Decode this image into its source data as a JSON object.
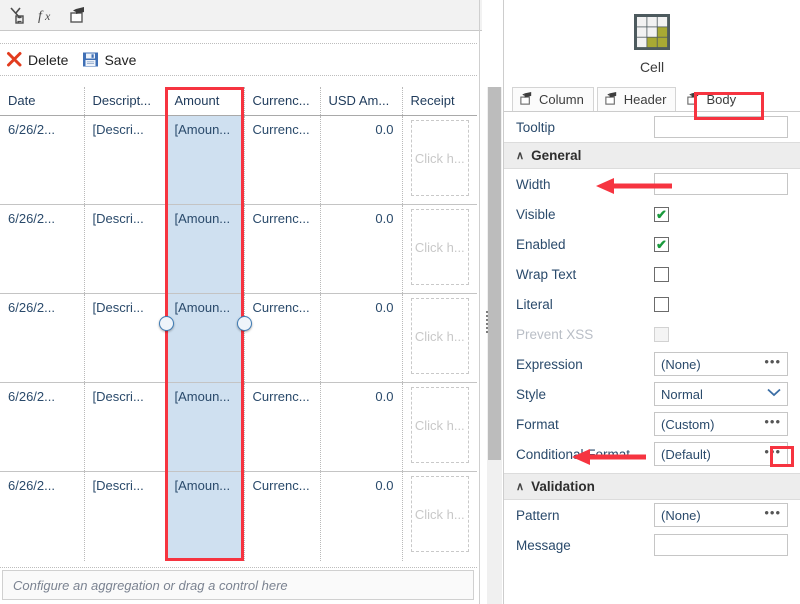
{
  "toolbar": {
    "icons": [
      {
        "name": "transform-icon",
        "label": "Transform"
      },
      {
        "name": "function-fx-icon",
        "label": "fx"
      },
      {
        "name": "control-insert-icon",
        "label": "Insert control"
      }
    ]
  },
  "command_bar": {
    "delete_label": "Delete",
    "save_label": "Save"
  },
  "grid": {
    "columns": [
      {
        "key": "date",
        "label": "Date",
        "align": "left"
      },
      {
        "key": "description",
        "label": "Descript...",
        "align": "left"
      },
      {
        "key": "amount",
        "label": "Amount",
        "align": "left",
        "selected": true
      },
      {
        "key": "currency",
        "label": "Currenc...",
        "align": "left"
      },
      {
        "key": "usd_amount",
        "label": "USD Am...",
        "align": "right"
      },
      {
        "key": "receipt",
        "label": "Receipt",
        "align": "left"
      }
    ],
    "rows": [
      {
        "date": "6/26/2...",
        "description": "[Descri...",
        "amount": "[Amoun...",
        "currency": "Currenc...",
        "usd_amount": "0.0",
        "receipt": "Click h..."
      },
      {
        "date": "6/26/2...",
        "description": "[Descri...",
        "amount": "[Amoun...",
        "currency": "Currenc...",
        "usd_amount": "0.0",
        "receipt": "Click h..."
      },
      {
        "date": "6/26/2...",
        "description": "[Descri...",
        "amount": "[Amoun...",
        "currency": "Currenc...",
        "usd_amount": "0.0",
        "receipt": "Click h..."
      },
      {
        "date": "6/26/2...",
        "description": "[Descri...",
        "amount": "[Amoun...",
        "currency": "Currenc...",
        "usd_amount": "0.0",
        "receipt": "Click h..."
      },
      {
        "date": "6/26/2...",
        "description": "[Descri...",
        "amount": "[Amoun...",
        "currency": "Currenc...",
        "usd_amount": "0.0",
        "receipt": "Click h..."
      }
    ],
    "aggregation_placeholder": "Configure an aggregation or drag a control here"
  },
  "properties": {
    "element_title": "Cell",
    "tabs": [
      {
        "id": "column",
        "label": "Column",
        "active": false
      },
      {
        "id": "header",
        "label": "Header",
        "active": false
      },
      {
        "id": "body",
        "label": "Body",
        "active": true,
        "highlighted": true
      }
    ],
    "top_rows": [
      {
        "label": "Tooltip",
        "type": "textbox",
        "value": ""
      }
    ],
    "sections": [
      {
        "id": "general",
        "title": "General",
        "expanded": true,
        "rows": [
          {
            "label": "Width",
            "type": "textbox",
            "value": ""
          },
          {
            "label": "Visible",
            "type": "checkbox",
            "checked": true,
            "disabled": false
          },
          {
            "label": "Enabled",
            "type": "checkbox",
            "checked": true,
            "disabled": false
          },
          {
            "label": "Wrap Text",
            "type": "checkbox",
            "checked": false,
            "disabled": false
          },
          {
            "label": "Literal",
            "type": "checkbox",
            "checked": false,
            "disabled": false
          },
          {
            "label": "Prevent XSS",
            "type": "checkbox",
            "checked": false,
            "disabled": true
          },
          {
            "label": "Expression",
            "type": "ellipsis",
            "value": "(None)"
          },
          {
            "label": "Style",
            "type": "dropdown",
            "value": "Normal"
          },
          {
            "label": "Format",
            "type": "ellipsis",
            "value": "(Custom)",
            "button_highlighted": true
          },
          {
            "label": "Conditional Format",
            "type": "ellipsis",
            "value": "(Default)"
          }
        ]
      },
      {
        "id": "validation",
        "title": "Validation",
        "expanded": true,
        "rows": [
          {
            "label": "Pattern",
            "type": "ellipsis",
            "value": "(None)"
          },
          {
            "label": "Message",
            "type": "textbox",
            "value": ""
          }
        ]
      }
    ],
    "ellipsis_glyph": "•••",
    "chevron_glyph": "❯",
    "check_glyph": "✔",
    "caret_glyph": "∧"
  },
  "annotations": {
    "colors": {
      "highlight_red": "#f63440",
      "selection_blue": "#cfe0f0",
      "header_blue": "#c5d9ec",
      "accent_olive": "#a8a933",
      "grid_dark": "#4d5a5e"
    },
    "arrows": [
      {
        "name": "arrow-to-general-section",
        "points_to": "General"
      },
      {
        "name": "arrow-to-format-row",
        "points_to": "Format"
      }
    ]
  }
}
